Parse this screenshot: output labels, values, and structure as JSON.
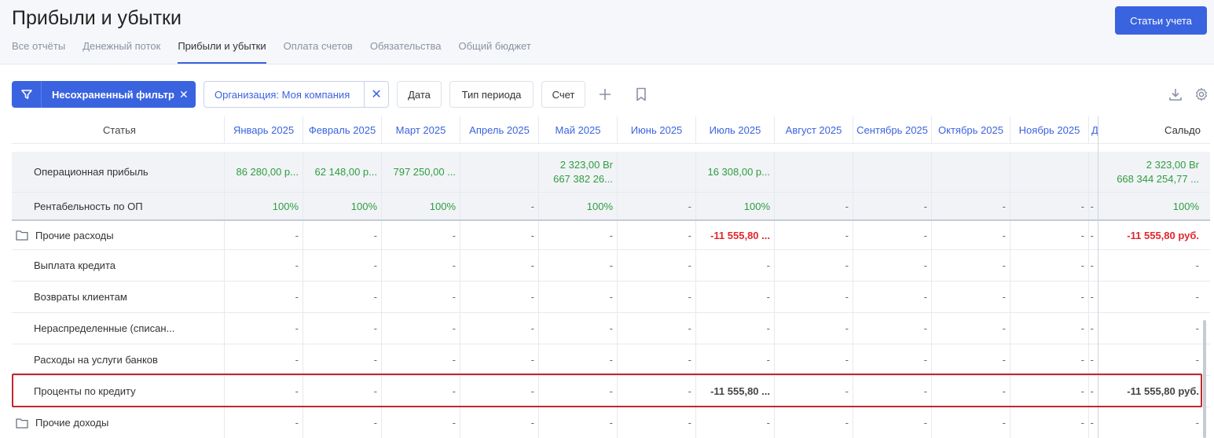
{
  "header": {
    "title": "Прибыли и убытки",
    "primary_button": "Статьи учета",
    "tabs": [
      "Все отчёты",
      "Денежный поток",
      "Прибыли и убытки",
      "Оплата счетов",
      "Обязательства",
      "Общий бюджет"
    ],
    "active_tab": "Прибыли и убытки"
  },
  "filters": {
    "main_filter": "Несохраненный фильтр",
    "organization": "Организация: Моя компания",
    "date": "Дата",
    "period_type": "Тип периода",
    "account": "Счет"
  },
  "table": {
    "columns": {
      "name": "Статья",
      "months": [
        "Январь 2025",
        "Февраль 2025",
        "Март 2025",
        "Апрель 2025",
        "Май 2025",
        "Июнь 2025",
        "Июль 2025",
        "Август 2025",
        "Сентябрь 2025",
        "Октябрь 2025",
        "Ноябрь 2025",
        "Д"
      ],
      "saldo": "Сальдо"
    },
    "rows": [
      {
        "name": "Операционная прибыль",
        "cells": [
          {
            "lines": [
              "86 280,00 р..."
            ]
          },
          {
            "lines": [
              "62 148,00 р..."
            ]
          },
          {
            "lines": [
              "797 250,00 ..."
            ]
          },
          {
            "lines": []
          },
          {
            "lines": [
              "2 323,00 Br",
              "667 382 26..."
            ]
          },
          {
            "lines": []
          },
          {
            "lines": [
              "16 308,00 р..."
            ]
          },
          {
            "lines": []
          },
          {
            "lines": []
          },
          {
            "lines": []
          },
          {
            "lines": []
          },
          {
            "lines": []
          }
        ],
        "saldo": [
          "2 323,00 Br",
          "668 344 254,77 ..."
        ]
      },
      {
        "name": "Рентабельность по ОП",
        "cells": [
          "100%",
          "100%",
          "100%",
          "-",
          "100%",
          "-",
          "100%",
          "-",
          "-",
          "-",
          "-",
          "-"
        ],
        "saldo": "100%"
      },
      {
        "name": "Прочие расходы",
        "cells": [
          "-",
          "-",
          "-",
          "-",
          "-",
          "-",
          "-11 555,80 ...",
          "-",
          "-",
          "-",
          "-",
          "-"
        ],
        "saldo": "-11 555,80 руб."
      },
      {
        "name": "Выплата кредита",
        "cells": [
          "-",
          "-",
          "-",
          "-",
          "-",
          "-",
          "-",
          "-",
          "-",
          "-",
          "-",
          "-"
        ],
        "saldo": "-"
      },
      {
        "name": "Возвраты клиентам",
        "cells": [
          "-",
          "-",
          "-",
          "-",
          "-",
          "-",
          "-",
          "-",
          "-",
          "-",
          "-",
          "-"
        ],
        "saldo": "-"
      },
      {
        "name": "Нераспределенные (списан...",
        "cells": [
          "-",
          "-",
          "-",
          "-",
          "-",
          "-",
          "-",
          "-",
          "-",
          "-",
          "-",
          "-"
        ],
        "saldo": "-"
      },
      {
        "name": "Расходы на услуги банков",
        "cells": [
          "-",
          "-",
          "-",
          "-",
          "-",
          "-",
          "-",
          "-",
          "-",
          "-",
          "-",
          "-"
        ],
        "saldo": "-"
      },
      {
        "name": "Проценты по кредиту",
        "cells": [
          "-",
          "-",
          "-",
          "-",
          "-",
          "-",
          "-11 555,80 ...",
          "-",
          "-",
          "-",
          "-",
          "-"
        ],
        "saldo": "-11 555,80 руб."
      },
      {
        "name": "Прочие доходы",
        "cells": [
          "-",
          "-",
          "-",
          "-",
          "-",
          "-",
          "-",
          "-",
          "-",
          "-",
          "-",
          "-"
        ],
        "saldo": "-"
      }
    ]
  },
  "colors": {
    "accent": "#3a63e0",
    "positive": "#2e9e3e",
    "negative": "#e0282e",
    "highlight_border": "#c0272d"
  }
}
